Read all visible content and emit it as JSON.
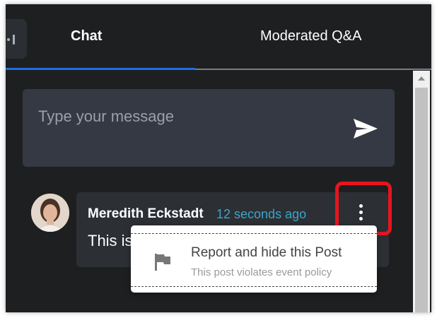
{
  "tabs": [
    {
      "label": "Chat",
      "active": true
    },
    {
      "label": "Moderated Q&A",
      "active": false
    }
  ],
  "composer": {
    "placeholder": "Type your message",
    "send_icon": "send-icon"
  },
  "message": {
    "author": "Meredith Eckstadt",
    "timestamp": "12 seconds ago",
    "text": "This is",
    "avatar_icon": "avatar"
  },
  "menu": {
    "items": [
      {
        "title": "Report and hide this Post",
        "subtitle": "This post violates event policy",
        "icon": "flag-icon"
      }
    ]
  },
  "colors": {
    "background": "#1e1f21",
    "accent": "#1e6fe0",
    "timestamp": "#3aa6c9",
    "highlight": "#e8141e"
  }
}
